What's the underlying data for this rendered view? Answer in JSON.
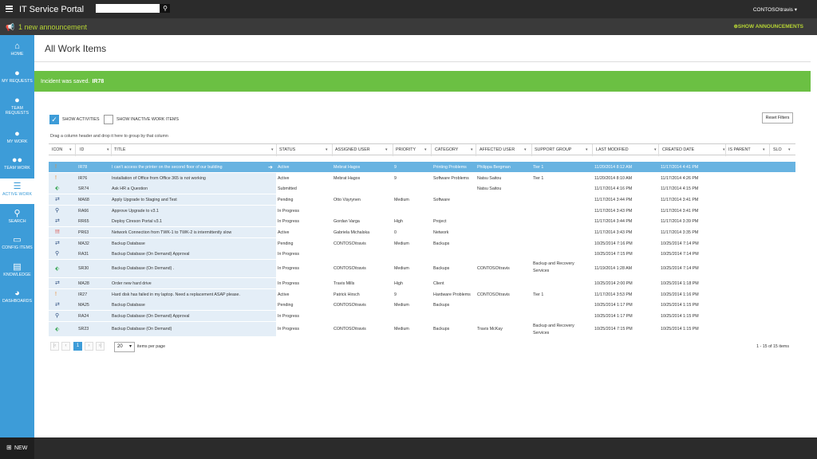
{
  "header": {
    "app_title": "IT Service Portal",
    "search_placeholder": "",
    "user": "CONTOSO\\travis"
  },
  "announcement": {
    "text": "1 new announcement",
    "show_label": "SHOW ANNOUNCEMENTS"
  },
  "sidebar": {
    "items": [
      {
        "label": "HOME",
        "icon": "home-icon"
      },
      {
        "label": "MY REQUESTS",
        "icon": "chat-icon"
      },
      {
        "label": "TEAM REQUESTS",
        "icon": "chat-group-icon"
      },
      {
        "label": "MY WORK",
        "icon": "person-icon"
      },
      {
        "label": "TEAM WORK",
        "icon": "people-icon"
      },
      {
        "label": "ACTIVE WORK",
        "icon": "list-icon"
      },
      {
        "label": "SEARCH",
        "icon": "search-icon"
      },
      {
        "label": "CONFIG ITEMS",
        "icon": "monitor-icon"
      },
      {
        "label": "KNOWLEDGE",
        "icon": "book-icon"
      },
      {
        "label": "DASHBOARDS",
        "icon": "pie-chart-icon"
      }
    ],
    "new_label": "NEW"
  },
  "main": {
    "title": "All Work Items",
    "alert_text": "Incident was saved.",
    "alert_id": "IR78",
    "show_activities": "SHOW ACTIVITIES",
    "show_inactive": "SHOW INACTIVE WORK ITEMS",
    "reset_filters": "Reset Filters",
    "group_hint": "Drag a column header and drop it here to group by that column"
  },
  "grid": {
    "columns": [
      "ICON",
      "ID",
      "TITLE",
      "STATUS",
      "ASSIGNED USER",
      "PRIORITY",
      "CATEGORY",
      "AFFECTED USER",
      "SUPPORT GROUP",
      "LAST MODIFIED",
      "CREATED DATE",
      "IS PARENT",
      "SLO"
    ],
    "rows": [
      {
        "icon": "!",
        "icon_color": "#e8862a",
        "id": "IR78",
        "title": "I can't access the printer on the second floor of our building",
        "status": "Active",
        "assigned": "Mebrat Hagos",
        "priority": "9",
        "category": "Printing Problems",
        "affected": "Philippa Bergman",
        "group": "Tier 1",
        "modified": "11/20/2014 8:12 AM",
        "created": "11/17/2014 4:41 PM"
      },
      {
        "icon": "!",
        "icon_color": "#e8862a",
        "id": "IR76",
        "title": "Installation of Office from Office 365 is not working",
        "status": "Active",
        "assigned": "Mebrat Hagos",
        "priority": "9",
        "category": "Software Problems",
        "affected": "Natsu Saitou",
        "group": "Tier 1",
        "modified": "11/20/2014 8:10 AM",
        "created": "11/17/2014 4:26 PM"
      },
      {
        "icon": "⬖",
        "icon_color": "#3aa655",
        "id": "SR74",
        "title": "Ask HR a Question",
        "status": "Submitted",
        "assigned": "",
        "priority": "",
        "category": "",
        "affected": "Natsu Saitou",
        "group": "",
        "modified": "11/17/2014 4:16 PM",
        "created": "11/17/2014 4:15 PM"
      },
      {
        "icon": "⇄",
        "icon_color": "#2f4f7f",
        "id": "MA68",
        "title": "Apply Upgrade to Staging and Test",
        "status": "Pending",
        "assigned": "Otto Väyrynen",
        "priority": "Medium",
        "category": "Software",
        "affected": "",
        "group": "",
        "modified": "11/17/2014 3:44 PM",
        "created": "11/17/2014 3:41 PM"
      },
      {
        "icon": "⚲",
        "icon_color": "#2f4f7f",
        "id": "RA66",
        "title": "Approve Upgrade to v3.1",
        "status": "In Progress",
        "assigned": "",
        "priority": "",
        "category": "",
        "affected": "",
        "group": "",
        "modified": "11/17/2014 3:43 PM",
        "created": "11/17/2014 3:41 PM"
      },
      {
        "icon": "⇄",
        "icon_color": "#2f4f7f",
        "id": "RR65",
        "title": "Deploy Cireson Portal v3.1",
        "status": "In Progress",
        "assigned": "Gordan Varga",
        "priority": "High",
        "category": "Project",
        "affected": "",
        "group": "",
        "modified": "11/17/2014 3:44 PM",
        "created": "11/17/2014 3:39 PM"
      },
      {
        "icon": "!!!",
        "icon_color": "#d9342b",
        "id": "PR63",
        "title": "Network Connection from TWK-1 to TWK-2 is intermittently slow",
        "status": "Active",
        "assigned": "Gabriela Michalska",
        "priority": "0",
        "category": "Network",
        "affected": "",
        "group": "",
        "modified": "11/17/2014 3:43 PM",
        "created": "11/17/2014 3:35 PM"
      },
      {
        "icon": "⇄",
        "icon_color": "#2f4f7f",
        "id": "MA32",
        "title": "Backup Database",
        "status": "Pending",
        "assigned": "CONTOSO\\travis",
        "priority": "Medium",
        "category": "Backups",
        "affected": "",
        "group": "",
        "modified": "10/25/2014 7:16 PM",
        "created": "10/25/2014 7:14 PM"
      },
      {
        "icon": "⚲",
        "icon_color": "#2f4f7f",
        "id": "RA31",
        "title": "Backup Database (On Demand) Approval",
        "status": "In Progress",
        "assigned": "",
        "priority": "",
        "category": "",
        "affected": "",
        "group": "",
        "modified": "10/25/2014 7:15 PM",
        "created": "10/25/2014 7:14 PM"
      },
      {
        "icon": "⬖",
        "icon_color": "#3aa655",
        "id": "SR30",
        "title": "Backup Database (On Demand) .",
        "status": "In Progress",
        "assigned": "CONTOSO\\travis",
        "priority": "Medium",
        "category": "Backups",
        "affected": "CONTOSO\\travis",
        "group": "Backup and Recovery Services",
        "modified": "11/19/2014 1:28 AM",
        "created": "10/25/2014 7:14 PM"
      },
      {
        "icon": "⇄",
        "icon_color": "#2f4f7f",
        "id": "MA28",
        "title": "Order new hard drive",
        "status": "In Progress",
        "assigned": "Travis Mills",
        "priority": "High",
        "category": "Client",
        "affected": "",
        "group": "",
        "modified": "10/25/2014 2:00 PM",
        "created": "10/25/2014 1:18 PM"
      },
      {
        "icon": "!",
        "icon_color": "#e8862a",
        "id": "IR27",
        "title": "Hard disk has failed in my laptop. Need a replacement ASAP please.",
        "status": "Active",
        "assigned": "Patrick Hirsch",
        "priority": "9",
        "category": "Hardware Problems",
        "affected": "CONTOSO\\travis",
        "group": "Tier 1",
        "modified": "11/17/2014 3:53 PM",
        "created": "10/25/2014 1:16 PM"
      },
      {
        "icon": "⇄",
        "icon_color": "#2f4f7f",
        "id": "MA25",
        "title": "Backup Database",
        "status": "Pending",
        "assigned": "CONTOSO\\travis",
        "priority": "Medium",
        "category": "Backups",
        "affected": "",
        "group": "",
        "modified": "10/25/2014 1:17 PM",
        "created": "10/25/2014 1:15 PM"
      },
      {
        "icon": "⚲",
        "icon_color": "#2f4f7f",
        "id": "RA24",
        "title": "Backup Database (On Demand) Approval",
        "status": "In Progress",
        "assigned": "",
        "priority": "",
        "category": "",
        "affected": "",
        "group": "",
        "modified": "10/25/2014 1:17 PM",
        "created": "10/25/2014 1:15 PM"
      },
      {
        "icon": "⬖",
        "icon_color": "#3aa655",
        "id": "SR23",
        "title": "Backup Database (On Demand)",
        "status": "In Progress",
        "assigned": "CONTOSO\\travis",
        "priority": "Medium",
        "category": "Backups",
        "affected": "Travis McKay",
        "group": "Backup and Recovery Services",
        "modified": "10/25/2014 7:15 PM",
        "created": "10/25/2014 1:15 PM"
      }
    ]
  },
  "pager": {
    "first": "|‹",
    "prev": "‹",
    "current": "1",
    "next": "›",
    "last": "›|",
    "page_size": "20",
    "items_label": "items per page",
    "range": "1 - 15 of 15 items"
  },
  "colors": {
    "accent": "#3d9cd8",
    "success": "#6bc043",
    "announcement": "#b5d334",
    "selected_row": "#68b3e1"
  }
}
